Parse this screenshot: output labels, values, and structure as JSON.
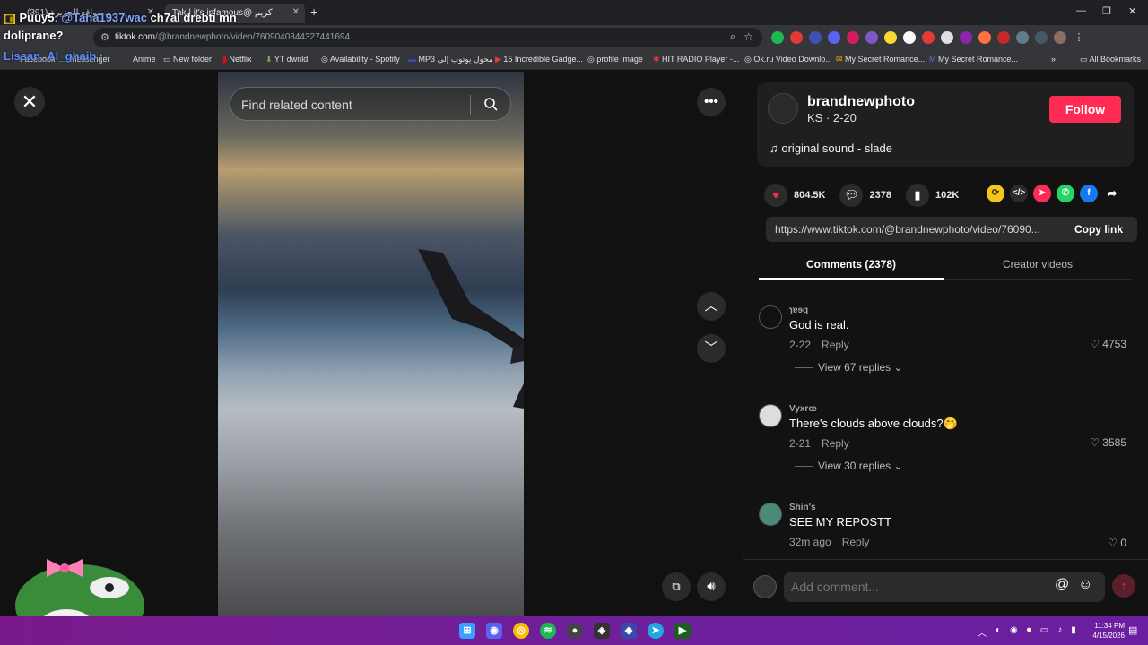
{
  "browser": {
    "tabs": [
      {
        "label": "(391) مواقع الجزيرة..."
      },
      {
        "label": "Tak | it's infamous@ كريم"
      }
    ],
    "url_domain": "tiktok.com",
    "url_path": "/@brandnewphoto/video/7609040344327441694",
    "bookmarks": [
      "Facebook",
      "Messenger",
      "Anime",
      "New folder",
      "Netflix",
      "YT dwnld",
      "Availability - Spotify",
      "MP3 محول يوتوب إلى",
      "15 Incredible Gadge...",
      "profile image",
      "HIT RADIO Player -...",
      "Ok.ru Video Downlo...",
      "My Secret Romance...",
      "My Secret Romance...",
      "All Bookmarks"
    ]
  },
  "overlay_chat": {
    "line1_user": "Puuy5",
    "line1_mention": ": @Taha1937wac",
    "line1_text": " ch7al drebti mn",
    "line2_text": "doliprane?",
    "line3_text": "Lissan_Al_ghaib :"
  },
  "video": {
    "search_placeholder": "Find related content"
  },
  "author": {
    "name": "brandnewphoto",
    "subtitle": "KS · 2-20",
    "follow_label": "Follow",
    "sound": "original sound - slade"
  },
  "stats": {
    "likes": "804.5K",
    "comments": "2378",
    "saves": "102K"
  },
  "share": {
    "link": "https://www.tiktok.com/@brandnewphoto/video/76090...",
    "copy_label": "Copy link"
  },
  "tabs": {
    "comments": "Comments (2378)",
    "creator_videos": "Creator videos"
  },
  "comments": [
    {
      "user": "ɿɐɘq",
      "text": "God is real.",
      "date": "2-22",
      "reply": "Reply",
      "likes": "4753",
      "replies": "View 67 replies"
    },
    {
      "user": "Vyxrœ",
      "text": "There's clouds above clouds?🤭",
      "date": "2-21",
      "reply": "Reply",
      "likes": "3585",
      "replies": "View 30 replies"
    },
    {
      "user": "Shin's",
      "text": "SEE MY REPOSTT",
      "date": "32m ago",
      "reply": "Reply",
      "likes": "0"
    }
  ],
  "comment_input": {
    "placeholder": "Add comment..."
  },
  "taskbar": {
    "time": "11:34 PM",
    "date": "4/15/2026"
  },
  "colors": {
    "follow": "#fe2c55",
    "like_heart": "#fe2c55"
  }
}
